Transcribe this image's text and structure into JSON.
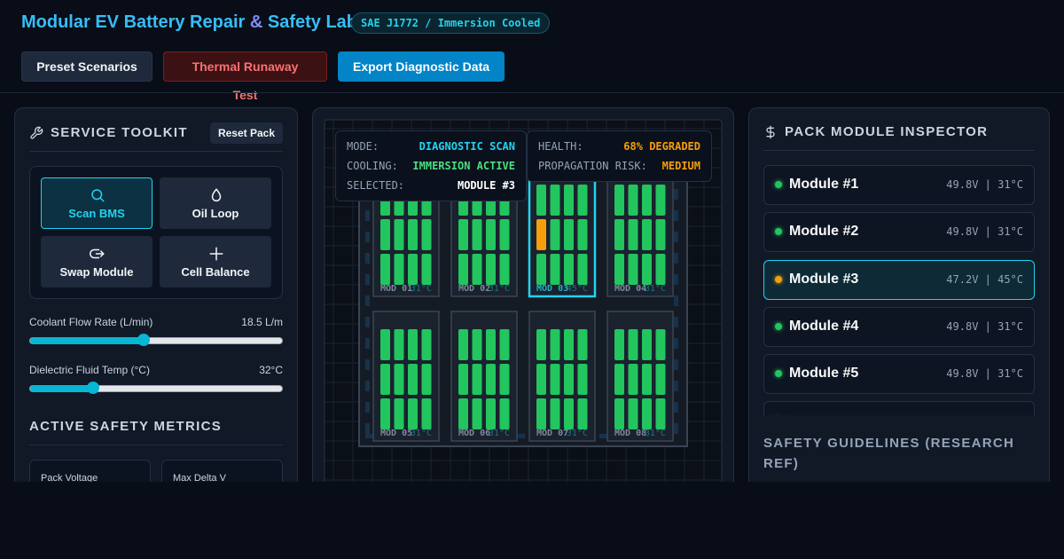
{
  "header": {
    "title_part1": "Modular EV Battery Repair ",
    "title_amp": "&",
    "title_part2": " Safety Lab",
    "badge": "SAE J1772 / Immersion Cooled",
    "buttons": {
      "preset": "Preset Scenarios",
      "thermal": "Thermal Runaway Test",
      "export": "Export Diagnostic Data"
    }
  },
  "toolkit": {
    "title": "SERVICE TOOLKIT",
    "reset_label": "Reset Pack",
    "tools": [
      {
        "label": "Scan BMS",
        "icon": "search-icon",
        "active": true
      },
      {
        "label": "Oil Loop",
        "icon": "droplet-icon",
        "active": false
      },
      {
        "label": "Swap Module",
        "icon": "swap-icon",
        "active": false
      },
      {
        "label": "Cell Balance",
        "icon": "plus-icon",
        "active": false
      }
    ],
    "coolant": {
      "label": "Coolant Flow Rate (L/min)",
      "value_text": "18.5 L/m",
      "fraction": 0.45
    },
    "fluid_temp": {
      "label": "Dielectric Fluid Temp (°C)",
      "value_text": "32°C",
      "fraction": 0.25
    }
  },
  "metrics": {
    "title": "ACTIVE SAFETY METRICS",
    "cards": [
      {
        "label": "Pack Voltage"
      },
      {
        "label": "Max Delta V"
      }
    ]
  },
  "status": {
    "mode_key": "MODE:",
    "mode_val": "DIAGNOSTIC SCAN",
    "cooling_key": "COOLING:",
    "cooling_val": "IMMERSION ACTIVE",
    "selected_key": "SELECTED:",
    "selected_val": "MODULE #3",
    "health_key": "HEALTH:",
    "health_val": "68% DEGRADED",
    "risk_key": "PROPAGATION RISK:",
    "risk_val": "MEDIUM"
  },
  "pack": {
    "colors": {
      "healthy": "#22c55e",
      "warning": "#f59e0b",
      "accent": "#22d3ee"
    },
    "modules": [
      {
        "label": "MOD 01",
        "temp": "31°C",
        "selected": false,
        "warn_cell": -1
      },
      {
        "label": "MOD 02",
        "temp": "31°C",
        "selected": false,
        "warn_cell": -1
      },
      {
        "label": "MOD 03",
        "temp": "45°C",
        "selected": true,
        "warn_cell": 4
      },
      {
        "label": "MOD 04",
        "temp": "31°C",
        "selected": false,
        "warn_cell": -1
      },
      {
        "label": "MOD 05",
        "temp": "31°C",
        "selected": false,
        "warn_cell": -1
      },
      {
        "label": "MOD 06",
        "temp": "31°C",
        "selected": false,
        "warn_cell": -1
      },
      {
        "label": "MOD 07",
        "temp": "31°C",
        "selected": false,
        "warn_cell": -1
      },
      {
        "label": "MOD 08",
        "temp": "31°C",
        "selected": false,
        "warn_cell": -1
      }
    ]
  },
  "inspector": {
    "title": "PACK MODULE INSPECTOR",
    "items": [
      {
        "name": "Module #1",
        "stats": "49.8V | 31°C",
        "status": "ok",
        "selected": false
      },
      {
        "name": "Module #2",
        "stats": "49.8V | 31°C",
        "status": "ok",
        "selected": false
      },
      {
        "name": "Module #3",
        "stats": "47.2V | 45°C",
        "status": "warn",
        "selected": true
      },
      {
        "name": "Module #4",
        "stats": "49.8V | 31°C",
        "status": "ok",
        "selected": false
      },
      {
        "name": "Module #5",
        "stats": "49.8V | 31°C",
        "status": "ok",
        "selected": false
      },
      {
        "name": "",
        "stats": "",
        "status": "ok",
        "selected": false
      }
    ],
    "guidelines_title": "SAFETY GUIDELINES (RESEARCH REF)"
  }
}
